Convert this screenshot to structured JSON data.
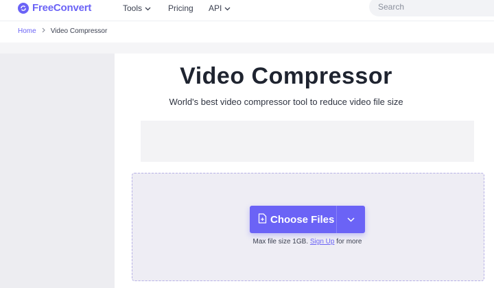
{
  "header": {
    "brand": "FreeConvert",
    "nav": [
      {
        "label": "Tools",
        "has_dropdown": true
      },
      {
        "label": "Pricing",
        "has_dropdown": false
      },
      {
        "label": "API",
        "has_dropdown": true
      }
    ],
    "search": {
      "placeholder": "Search",
      "value": ""
    }
  },
  "breadcrumb": {
    "home": "Home",
    "current": "Video Compressor"
  },
  "main": {
    "title": "Video Compressor",
    "subtitle": "World's best video compressor tool to reduce video file size",
    "upload": {
      "button_label": "Choose Files",
      "max_size_text": "Max file size 1GB.",
      "signup_link": "Sign Up",
      "suffix_text": "for more"
    }
  },
  "colors": {
    "accent": "#6b63f6",
    "dropzone_bg": "#eeedf4",
    "dropzone_border": "#b6b0e6",
    "sidebar_bg": "#ededf1"
  },
  "icons": [
    "logo-icon",
    "chevron-down-icon",
    "file-plus-icon"
  ]
}
